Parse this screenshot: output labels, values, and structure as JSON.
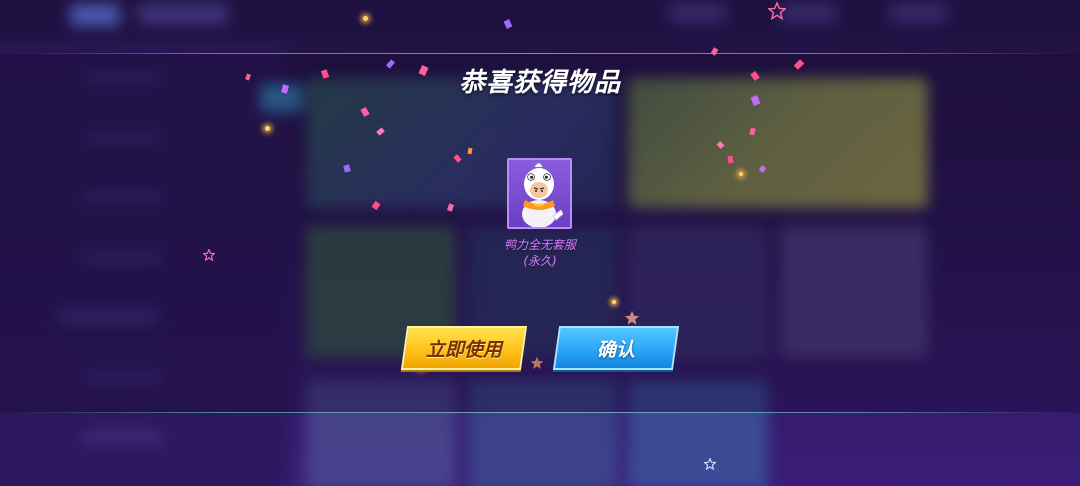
{
  "dialog": {
    "title": "恭喜获得物品"
  },
  "item": {
    "name": "鸭力全无套服",
    "duration": "(永久)",
    "icon": "duck-costume-icon"
  },
  "buttons": {
    "use_label": "立即使用",
    "confirm_label": "确认"
  },
  "colors": {
    "item_name": "#d77bff",
    "use_button": "#ffc21c",
    "confirm_button": "#2aa6f5",
    "background": "#281653"
  }
}
